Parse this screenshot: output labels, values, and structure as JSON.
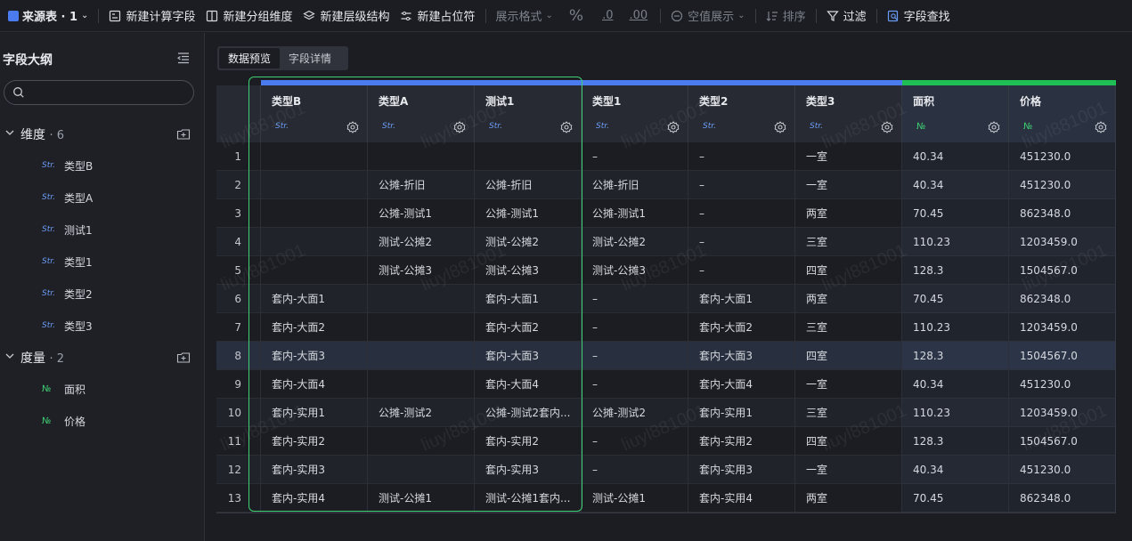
{
  "toolbar": {
    "source": "来源表 · 1",
    "items": [
      {
        "label": "新建计算字段",
        "icon": "calculated-field-icon"
      },
      {
        "label": "新建分组维度",
        "icon": "group-dimension-icon"
      },
      {
        "label": "新建层级结构",
        "icon": "hierarchy-icon"
      },
      {
        "label": "新建占位符",
        "icon": "placeholder-icon"
      }
    ],
    "display_format": "展示格式",
    "percent": "%",
    "decimal_decrease": ".0",
    "decimal_increase": ".00",
    "null_display": "空值展示",
    "sort": "排序",
    "filter": "过滤",
    "field_search": "字段查找"
  },
  "sidebar": {
    "title": "字段大纲",
    "search_placeholder": "",
    "dimensions": {
      "label": "维度",
      "count": "· 6",
      "fields": [
        {
          "type": "Str.",
          "name": "类型B"
        },
        {
          "type": "Str.",
          "name": "类型A"
        },
        {
          "type": "Str.",
          "name": "测试1"
        },
        {
          "type": "Str.",
          "name": "类型1"
        },
        {
          "type": "Str.",
          "name": "类型2"
        },
        {
          "type": "Str.",
          "name": "类型3"
        }
      ]
    },
    "measures": {
      "label": "度量",
      "count": "· 2",
      "fields": [
        {
          "type": "№",
          "name": "面积"
        },
        {
          "type": "№",
          "name": "价格"
        }
      ]
    }
  },
  "tabs": {
    "preview": "数据预览",
    "details": "字段详情"
  },
  "grid": {
    "columns": [
      {
        "name": "类型B",
        "type": "Str."
      },
      {
        "name": "类型A",
        "type": "Str."
      },
      {
        "name": "测试1",
        "type": "Str."
      },
      {
        "name": "类型1",
        "type": "Str."
      },
      {
        "name": "类型2",
        "type": "Str."
      },
      {
        "name": "类型3",
        "type": "Str."
      },
      {
        "name": "面积",
        "type": "№"
      },
      {
        "name": "价格",
        "type": "№"
      }
    ],
    "rows": [
      {
        "n": "1",
        "c": [
          "",
          "",
          "",
          "–",
          "–",
          "一室",
          "40.34",
          "451230.0"
        ]
      },
      {
        "n": "2",
        "c": [
          "",
          "公摊-折旧",
          "公摊-折旧",
          "公摊-折旧",
          "–",
          "一室",
          "40.34",
          "451230.0"
        ]
      },
      {
        "n": "3",
        "c": [
          "",
          "公摊-测试1",
          "公摊-测试1",
          "公摊-测试1",
          "–",
          "两室",
          "70.45",
          "862348.0"
        ]
      },
      {
        "n": "4",
        "c": [
          "",
          "测试-公摊2",
          "测试-公摊2",
          "测试-公摊2",
          "–",
          "三室",
          "110.23",
          "1203459.0"
        ]
      },
      {
        "n": "5",
        "c": [
          "",
          "测试-公摊3",
          "测试-公摊3",
          "测试-公摊3",
          "–",
          "四室",
          "128.3",
          "1504567.0"
        ]
      },
      {
        "n": "6",
        "c": [
          "套内-大面1",
          "",
          "套内-大面1",
          "–",
          "套内-大面1",
          "两室",
          "70.45",
          "862348.0"
        ]
      },
      {
        "n": "7",
        "c": [
          "套内-大面2",
          "",
          "套内-大面2",
          "–",
          "套内-大面2",
          "三室",
          "110.23",
          "1203459.0"
        ]
      },
      {
        "n": "8",
        "c": [
          "套内-大面3",
          "",
          "套内-大面3",
          "–",
          "套内-大面3",
          "四室",
          "128.3",
          "1504567.0"
        ]
      },
      {
        "n": "9",
        "c": [
          "套内-大面4",
          "",
          "套内-大面4",
          "–",
          "套内-大面4",
          "一室",
          "40.34",
          "451230.0"
        ]
      },
      {
        "n": "10",
        "c": [
          "套内-实用1",
          "公摊-测试2",
          "公摊-测试2套内...",
          "公摊-测试2",
          "套内-实用1",
          "三室",
          "110.23",
          "1203459.0"
        ]
      },
      {
        "n": "11",
        "c": [
          "套内-实用2",
          "",
          "套内-实用2",
          "–",
          "套内-实用2",
          "四室",
          "128.3",
          "1504567.0"
        ]
      },
      {
        "n": "12",
        "c": [
          "套内-实用3",
          "",
          "套内-实用3",
          "–",
          "套内-实用3",
          "一室",
          "40.34",
          "451230.0"
        ]
      },
      {
        "n": "13",
        "c": [
          "套内-实用4",
          "测试-公摊1",
          "测试-公摊1套内...",
          "测试-公摊1",
          "套内-实用4",
          "两室",
          "70.45",
          "862348.0"
        ]
      }
    ],
    "highlighted_row": 8
  },
  "watermark": "liuyl881001",
  "colors": {
    "dimension_strip": "#4a7cf0",
    "measure_strip": "#1fbf55",
    "selection": "#3fcf74",
    "str_type": "#6b9cf5",
    "num_type": "#3fcf74"
  }
}
